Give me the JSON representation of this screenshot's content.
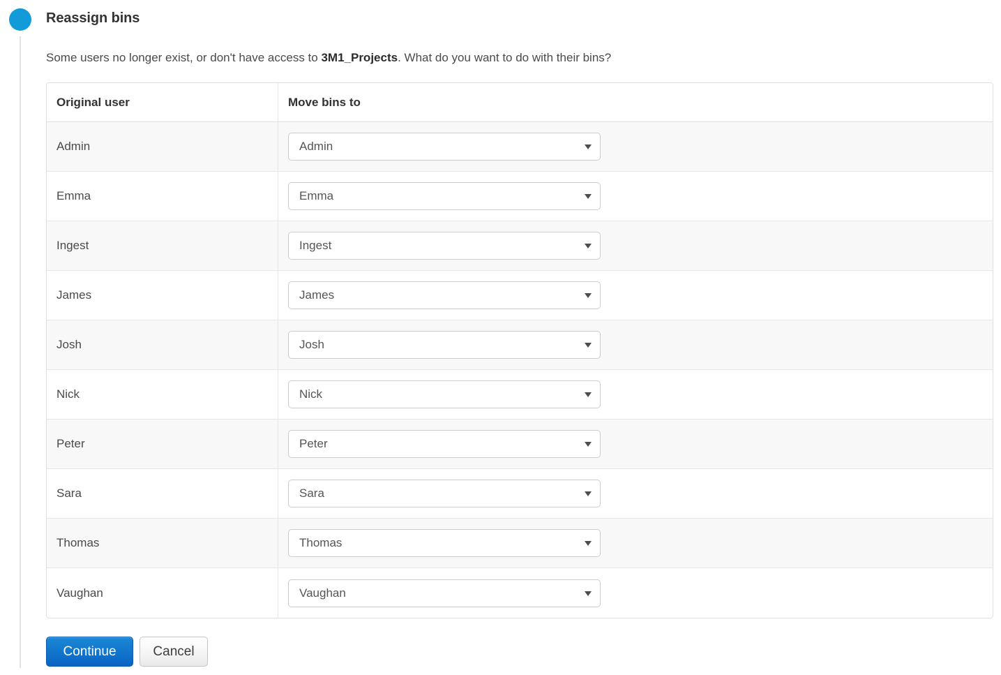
{
  "step": {
    "bullet_color": "#139ad9",
    "title": "Reassign bins"
  },
  "intro": {
    "before": "Some users no longer exist, or don't have access to ",
    "emphasis": "3M1_Projects",
    "after": ". What do you want to do with their bins?"
  },
  "table": {
    "headers": {
      "original_user": "Original user",
      "move_bins_to": "Move bins to"
    },
    "rows": [
      {
        "original_user": "Admin",
        "target": "Admin"
      },
      {
        "original_user": "Emma",
        "target": "Emma"
      },
      {
        "original_user": "Ingest",
        "target": "Ingest"
      },
      {
        "original_user": "James",
        "target": "James"
      },
      {
        "original_user": "Josh",
        "target": "Josh"
      },
      {
        "original_user": "Nick",
        "target": "Nick"
      },
      {
        "original_user": "Peter",
        "target": "Peter"
      },
      {
        "original_user": "Sara",
        "target": "Sara"
      },
      {
        "original_user": "Thomas",
        "target": "Thomas"
      },
      {
        "original_user": "Vaughan",
        "target": "Vaughan"
      }
    ]
  },
  "buttons": {
    "continue_label": "Continue",
    "cancel_label": "Cancel",
    "primary_color": "#1278cd"
  },
  "icons": {
    "select_arrow": "chevron-down-icon",
    "step_bullet": "step-bullet-icon"
  }
}
